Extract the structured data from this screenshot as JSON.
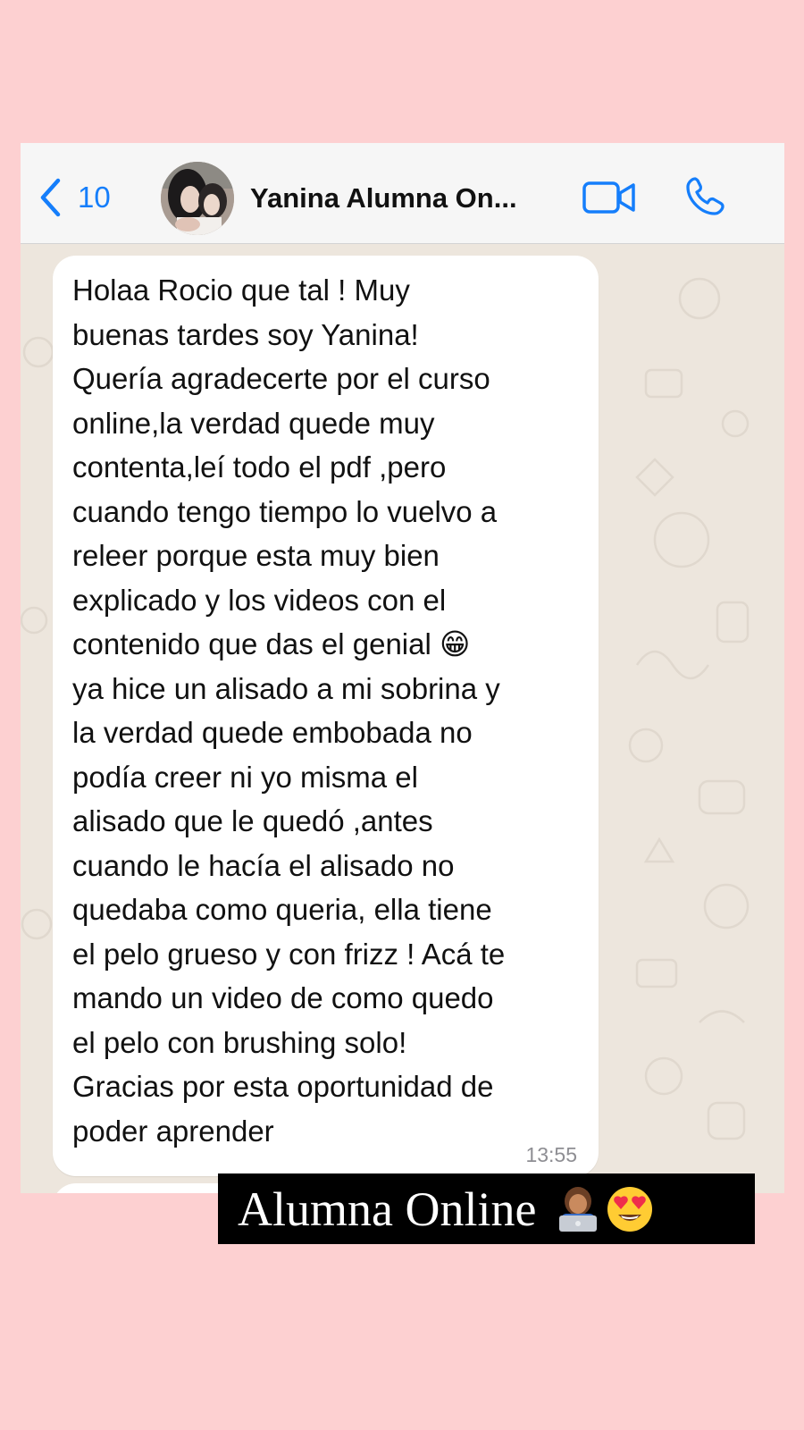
{
  "header": {
    "back_count": "10",
    "contact_name": "Yanina Alumna On...",
    "icons": {
      "back": "chevron-left-icon",
      "video": "video-camera-icon",
      "call": "phone-icon"
    },
    "accent_color": "#157efb"
  },
  "message": {
    "text": "Holaa Rocio que tal ! Muy\nbuenas tardes soy Yanina!\nQuería agradecerte por el curso\nonline,la verdad quede muy\ncontenta,leí todo el pdf ,pero\ncuando tengo tiempo lo vuelvo a\nreleer porque esta muy bien\nexplicado y los videos con el\ncontenido que das el genial 😁\nya hice un alisado a mi sobrina y\nla verdad quede embobada no\npodía creer ni yo misma el\nalisado que le quedó  ,antes\ncuando le hacía el alisado no\nquedaba como queria, ella tiene\nel pelo grueso y con frizz ! Acá te\nmando un video de como quedo\nel pelo con brushing solo!\nGracias por esta oportunidad de\npoder aprender",
    "time": "13:55"
  },
  "overlay": {
    "label": "Alumna Online",
    "emojis": [
      "woman-technologist-icon",
      "heart-eyes-icon"
    ]
  },
  "colors": {
    "page_background": "#fdd0d1",
    "chat_background": "#ede6dd",
    "header_background": "#f6f6f6",
    "bubble_background": "#ffffff",
    "overlay_background": "#000000"
  }
}
